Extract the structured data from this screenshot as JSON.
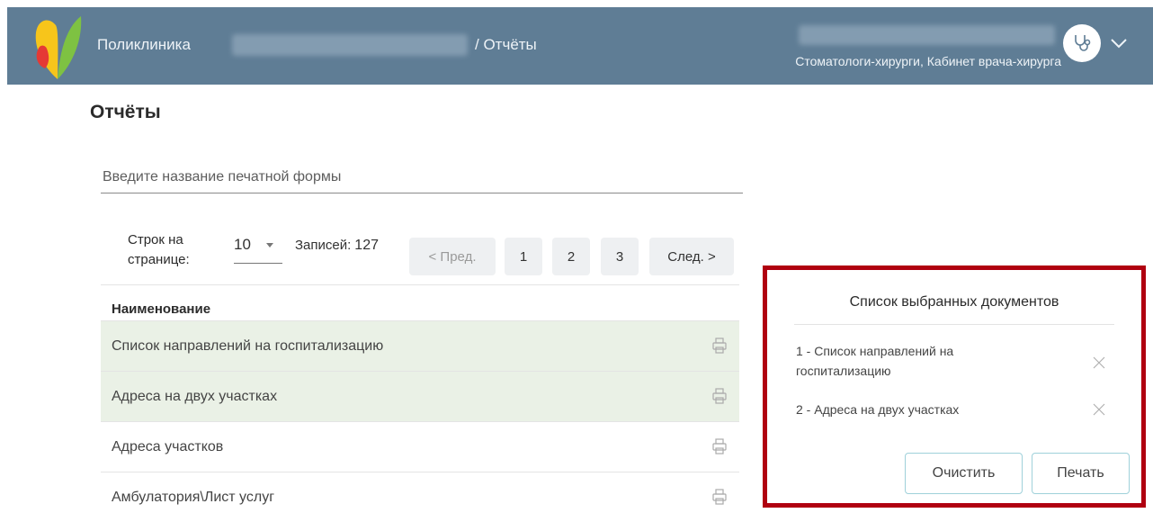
{
  "header": {
    "clinic_label": "Поликлиника",
    "breadcrumb": "/ Отчёты",
    "role": "Стоматологи-хирурги, Кабинет врача-хирурга",
    "avatar_icon": "stethoscope-icon",
    "menu_icon": "chevron-down-icon"
  },
  "page": {
    "title": "Отчёты"
  },
  "search": {
    "placeholder": "Введите название печатной формы"
  },
  "pager": {
    "rows_label": "Строк на странице:",
    "rows_value": "10",
    "records_label": "Записей:",
    "records_count": "127",
    "prev": "< Пред.",
    "pages": [
      "1",
      "2",
      "3"
    ],
    "next": "След. >"
  },
  "table": {
    "header": "Наименование",
    "rows": [
      {
        "name": "Список направлений на госпитализацию",
        "selected": true
      },
      {
        "name": "Адреса на двух участках",
        "selected": true
      },
      {
        "name": "Адреса участков",
        "selected": false
      },
      {
        "name": "Амбулатория\\Лист услуг",
        "selected": false
      }
    ]
  },
  "selected_panel": {
    "title": "Список выбранных документов",
    "items": [
      "1 - Список направлений на госпитализацию",
      "2 - Адреса на двух участках"
    ],
    "clear_label": "Очистить",
    "print_label": "Печать",
    "border_color": "#b00010"
  },
  "colors": {
    "header_bg": "#5f7d95",
    "selected_row_bg": "#eaf1e6"
  }
}
